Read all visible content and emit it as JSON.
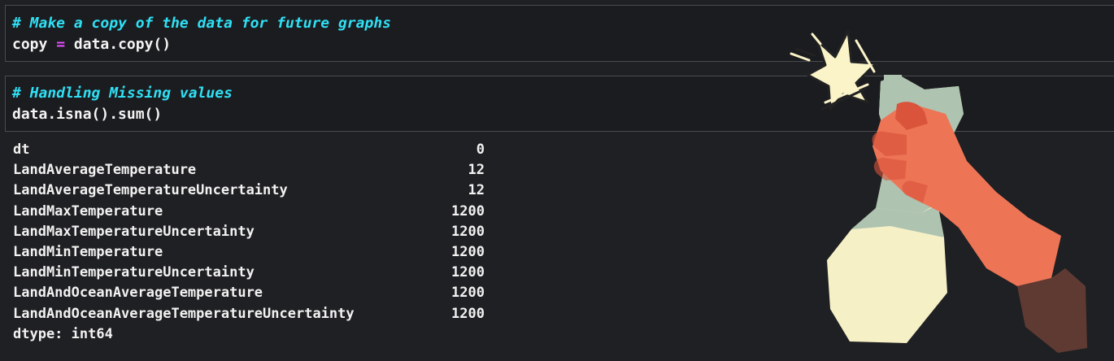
{
  "cells": [
    {
      "comment": "# Make a copy of the data for future graphs",
      "code_left": "copy",
      "code_op": "=",
      "code_right": "data.copy()"
    },
    {
      "comment": "# Handling Missing values",
      "code": "data.isna().sum()"
    }
  ],
  "output": {
    "rows": [
      {
        "name": "dt",
        "value": "0"
      },
      {
        "name": "LandAverageTemperature",
        "value": "12"
      },
      {
        "name": "LandAverageTemperatureUncertainty",
        "value": "12"
      },
      {
        "name": "LandMaxTemperature",
        "value": "1200"
      },
      {
        "name": "LandMaxTemperatureUncertainty",
        "value": "1200"
      },
      {
        "name": "LandMinTemperature",
        "value": "1200"
      },
      {
        "name": "LandMinTemperatureUncertainty",
        "value": "1200"
      },
      {
        "name": "LandAndOceanAverageTemperature",
        "value": "1200"
      },
      {
        "name": "LandAndOceanAverageTemperatureUncertainty",
        "value": "1200"
      }
    ],
    "dtype": "dtype: int64"
  },
  "illustration": {
    "icon": "spray-bottle-hand-icon",
    "colors": {
      "glove": "#ee7456",
      "glove_dark": "#d9543a",
      "bottle": "#f6f0c6",
      "bottle_top": "#aec3b0",
      "sleeve": "#5e3a33",
      "burst": "#fbf4c9"
    }
  }
}
